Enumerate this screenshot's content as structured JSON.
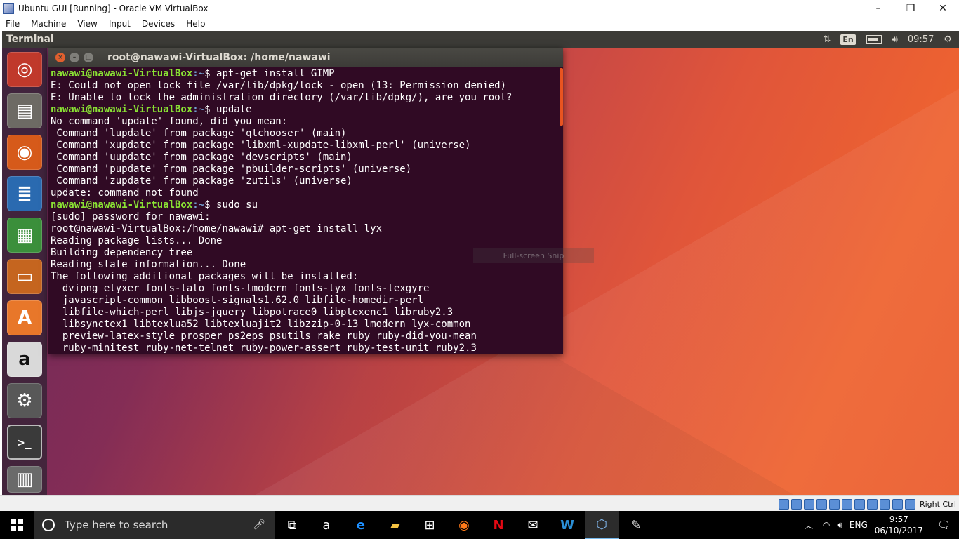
{
  "vbox": {
    "title": "Ubuntu GUI [Running] - Oracle VM VirtualBox",
    "menu": [
      "File",
      "Machine",
      "View",
      "Input",
      "Devices",
      "Help"
    ],
    "window_controls": {
      "minimize": "–",
      "restore": "❐",
      "close": "✕"
    },
    "host_key": "Right Ctrl"
  },
  "ubuntu": {
    "panel_title": "Terminal",
    "tray": {
      "lang": "En",
      "time": "09:57"
    },
    "launcher": [
      {
        "name": "ubuntu-dash-icon",
        "glyph": "◎"
      },
      {
        "name": "files-icon",
        "glyph": "▤"
      },
      {
        "name": "firefox-icon",
        "glyph": "◉"
      },
      {
        "name": "writer-icon",
        "glyph": "≣"
      },
      {
        "name": "calc-icon",
        "glyph": "▦"
      },
      {
        "name": "impress-icon",
        "glyph": "▭"
      },
      {
        "name": "software-center-icon",
        "glyph": "A"
      },
      {
        "name": "amazon-icon",
        "glyph": "a"
      },
      {
        "name": "system-settings-icon",
        "glyph": "⚙"
      },
      {
        "name": "terminal-icon",
        "glyph": ">_"
      },
      {
        "name": "trash-icon",
        "glyph": "▥"
      }
    ]
  },
  "terminal": {
    "title": "root@nawawi-VirtualBox: /home/nawawi",
    "lines": [
      {
        "user": "nawawi@nawawi-VirtualBox",
        "path": ":~",
        "text": "$ apt-get install GIMP"
      },
      {
        "text": "E: Could not open lock file /var/lib/dpkg/lock - open (13: Permission denied)"
      },
      {
        "text": "E: Unable to lock the administration directory (/var/lib/dpkg/), are you root?"
      },
      {
        "user": "nawawi@nawawi-VirtualBox",
        "path": ":~",
        "text": "$ update"
      },
      {
        "text": "No command 'update' found, did you mean:"
      },
      {
        "text": " Command 'lupdate' from package 'qtchooser' (main)"
      },
      {
        "text": " Command 'xupdate' from package 'libxml-xupdate-libxml-perl' (universe)"
      },
      {
        "text": " Command 'uupdate' from package 'devscripts' (main)"
      },
      {
        "text": " Command 'pupdate' from package 'pbuilder-scripts' (universe)"
      },
      {
        "text": " Command 'zupdate' from package 'zutils' (universe)"
      },
      {
        "text": "update: command not found"
      },
      {
        "user": "nawawi@nawawi-VirtualBox",
        "path": ":~",
        "text": "$ sudo su"
      },
      {
        "text": "[sudo] password for nawawi:"
      },
      {
        "text": "root@nawawi-VirtualBox:/home/nawawi# apt-get install lyx"
      },
      {
        "text": "Reading package lists... Done"
      },
      {
        "text": "Building dependency tree"
      },
      {
        "text": "Reading state information... Done"
      },
      {
        "text": "The following additional packages will be installed:"
      },
      {
        "text": "  dvipng elyxer fonts-lato fonts-lmodern fonts-lyx fonts-texgyre"
      },
      {
        "text": "  javascript-common libboost-signals1.62.0 libfile-homedir-perl"
      },
      {
        "text": "  libfile-which-perl libjs-jquery libpotrace0 libptexenc1 libruby2.3"
      },
      {
        "text": "  libsynctex1 libtexlua52 libtexluajit2 libzzip-0-13 lmodern lyx-common"
      },
      {
        "text": "  preview-latex-style prosper ps2eps psutils rake ruby ruby-did-you-mean"
      },
      {
        "text": "  ruby-minitest ruby-net-telnet ruby-power-assert ruby-test-unit ruby2.3"
      }
    ],
    "snip_overlay": "Full-screen Snip"
  },
  "taskbar": {
    "search_placeholder": "Type here to search",
    "apps": [
      {
        "name": "task-view-icon",
        "glyph": "⧉",
        "color": "#ffffff"
      },
      {
        "name": "amazon-app-icon",
        "glyph": "a",
        "color": "#ffffff"
      },
      {
        "name": "edge-icon",
        "glyph": "e",
        "color": "#1e90ff"
      },
      {
        "name": "file-explorer-icon",
        "glyph": "▰",
        "color": "#f5c342"
      },
      {
        "name": "store-icon",
        "glyph": "⊞",
        "color": "#ffffff"
      },
      {
        "name": "firefox-taskbar-icon",
        "glyph": "◉",
        "color": "#ff7a1a"
      },
      {
        "name": "netflix-icon",
        "glyph": "N",
        "color": "#e50914"
      },
      {
        "name": "mail-icon",
        "glyph": "✉",
        "color": "#ffffff"
      },
      {
        "name": "word-app-icon",
        "glyph": "W",
        "color": "#2b8fd6"
      },
      {
        "name": "virtualbox-icon",
        "glyph": "⬡",
        "color": "#7fb3e8"
      },
      {
        "name": "paint-icon",
        "glyph": "✎",
        "color": "#d0d0d0"
      }
    ],
    "tray": {
      "lang": "ENG",
      "time": "9:57",
      "date": "06/10/2017"
    }
  }
}
